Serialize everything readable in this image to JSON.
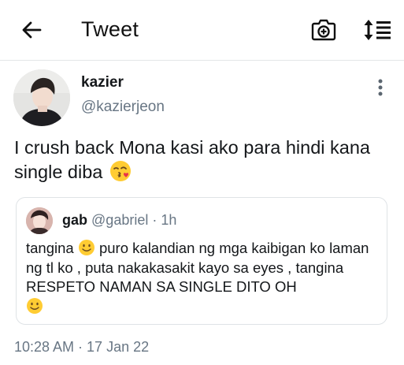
{
  "header": {
    "title": "Tweet"
  },
  "tweet": {
    "author_name": "kazier",
    "author_handle": "@kazierjeon",
    "text": "I crush back Mona kasi ako para hindi kana single diba",
    "timestamp": "10:28 AM · 17 Jan 22"
  },
  "quote": {
    "author_name": "gab",
    "author_handle": "@gabriel",
    "separator": " · ",
    "time": "1h",
    "text_part1": "tangina ",
    "text_part2": " puro kalandian ng mga kaibigan ko laman ng tl ko , puta nakakasakit kayo sa eyes , tangina RESPETO NAMAN SA SINGLE DITO OH"
  },
  "icons": {
    "back": "arrow-left-icon",
    "camera": "camera-plus-icon",
    "sort": "sort-arrows-icon",
    "more": "vertical-dots-icon",
    "kiss": "face-blowing-kiss-emoji",
    "smile": "slightly-smiling-face-emoji"
  },
  "colors": {
    "text_primary": "#14171a",
    "text_secondary": "#687684",
    "border": "#dfe3e6"
  }
}
